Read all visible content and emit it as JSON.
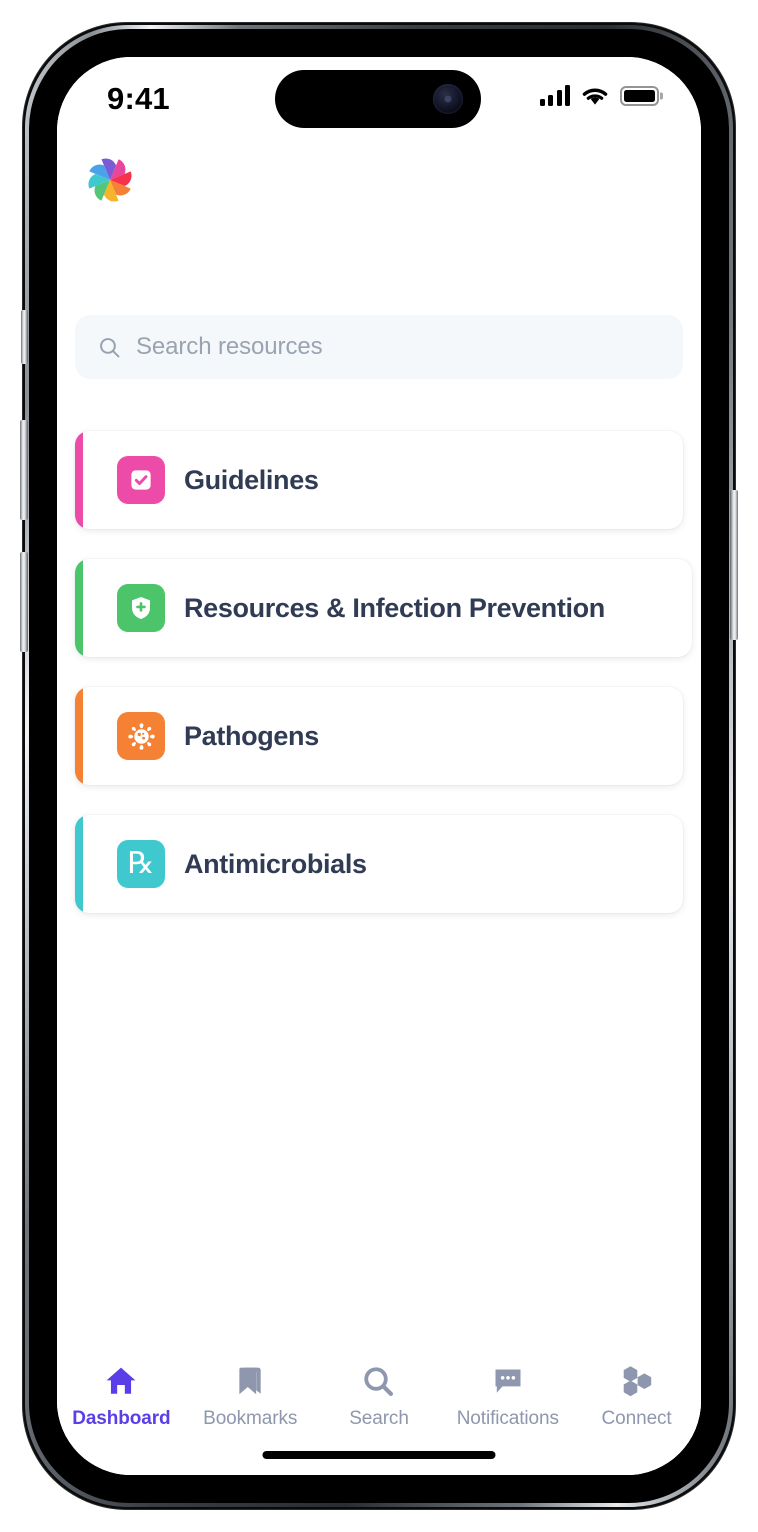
{
  "status_bar": {
    "time": "9:41",
    "cellular_icon": "cellular-signal-icon",
    "wifi_icon": "wifi-icon",
    "battery_icon": "battery-full-icon"
  },
  "header": {
    "logo_icon": "app-logo-pinwheel-icon",
    "logo_colors": [
      "#4aa3e8",
      "#7b5cd6",
      "#e8469b",
      "#3fc9ce",
      "#f5334b",
      "#55c57a",
      "#f7b32b",
      "#f58134"
    ]
  },
  "search": {
    "icon": "search-icon",
    "placeholder": "Search resources",
    "value": ""
  },
  "cards": [
    {
      "label": "Guidelines",
      "icon": "checkbox-check-icon",
      "accent_color": "#ED4BA8",
      "tile_color": "#ED4BA8"
    },
    {
      "label": "Resources & Infection Prevention",
      "icon": "shield-plus-icon",
      "accent_color": "#4CC46A",
      "tile_color": "#4CC46A"
    },
    {
      "label": "Pathogens",
      "icon": "virus-icon",
      "accent_color": "#F58134",
      "tile_color": "#F58134"
    },
    {
      "label": "Antimicrobials",
      "icon": "prescription-rx-icon",
      "accent_color": "#3FC9CE",
      "tile_color": "#3FC9CE"
    }
  ],
  "tabbar": {
    "active_color": "#5A3FE8",
    "inactive_color": "#8E97AD",
    "items": [
      {
        "label": "Dashboard",
        "icon": "home-icon",
        "active": true
      },
      {
        "label": "Bookmarks",
        "icon": "bookmark-icon",
        "active": false
      },
      {
        "label": "Search",
        "icon": "search-icon",
        "active": false
      },
      {
        "label": "Notifications",
        "icon": "chat-bubble-icon",
        "active": false
      },
      {
        "label": "Connect",
        "icon": "hexagon-cluster-icon",
        "active": false
      }
    ]
  }
}
